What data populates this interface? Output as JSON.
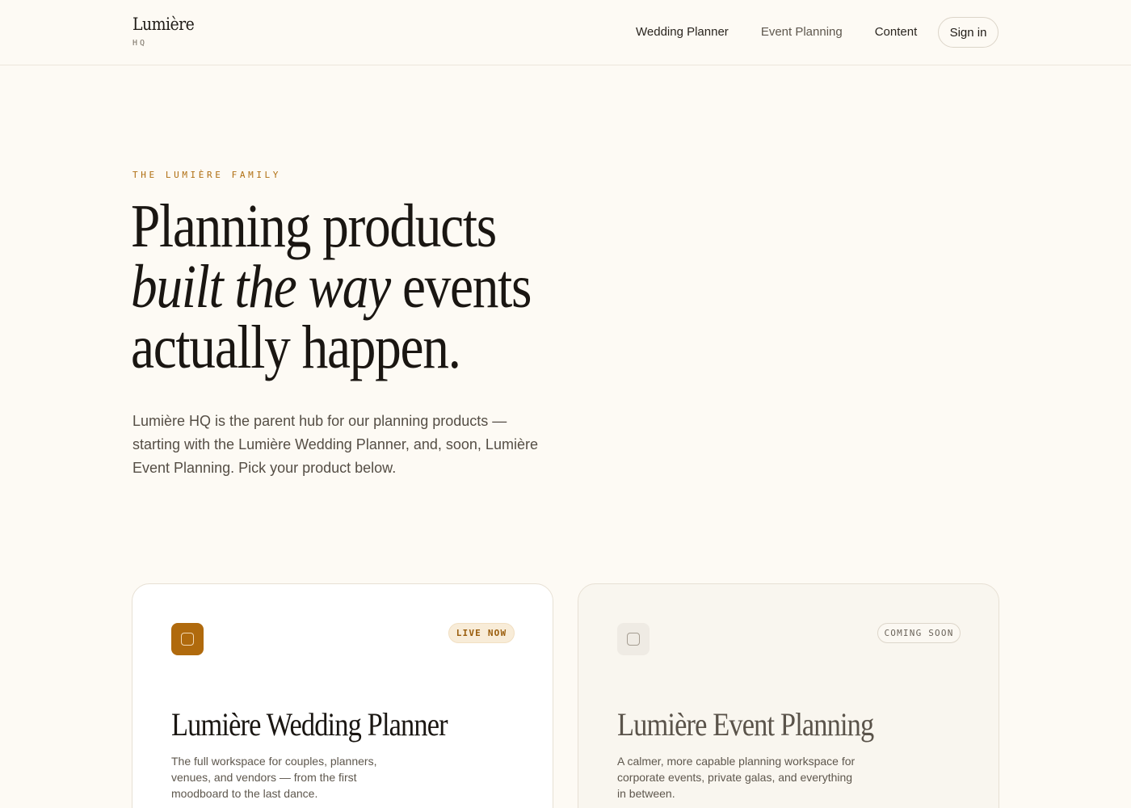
{
  "header": {
    "brand_name": "Lumière",
    "brand_sub": "HQ",
    "nav": [
      {
        "label": "Wedding Planner"
      },
      {
        "label": "Event Planning"
      },
      {
        "label": "Content"
      }
    ],
    "signin_label": "Sign in"
  },
  "hero": {
    "eyebrow": "THE LUMIÈRE FAMILY",
    "headline_line1": "Planning products",
    "headline_italic": "built the way",
    "headline_line2_rest": " events",
    "headline_line3": "actually happen.",
    "lede": "Lumière HQ is the parent hub for our planning products — starting with the Lumière Wedding Planner, and, soon, Lumière Event Planning. Pick your product below."
  },
  "products": [
    {
      "badge": "LIVE NOW",
      "title": "Lumière Wedding Planner",
      "description": "The full workspace for couples, planners, venues, and vendors — from the first moodboard to the last dance.",
      "icon": "square-app-icon",
      "accent": "#b06a0d"
    },
    {
      "badge": "COMING SOON",
      "title": "Lumière Event Planning",
      "description": "A calmer, more capable planning workspace for corporate events, private galas, and everything in between.",
      "icon": "square-app-icon",
      "accent": "#efebe4"
    }
  ],
  "colors": {
    "background": "#fdfaf4",
    "accent": "#b06f12",
    "text": "#1a1612"
  }
}
